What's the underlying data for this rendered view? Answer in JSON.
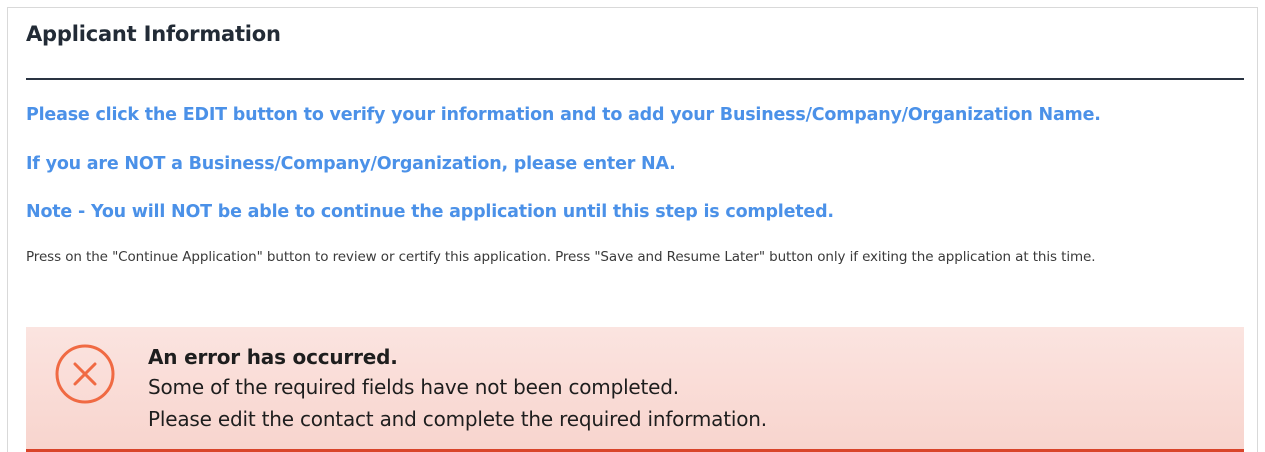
{
  "section": {
    "title": "Applicant Information"
  },
  "instructions": {
    "line1": "Please click the EDIT button to verify your information and to add your Business/Company/Organization Name.",
    "line2": "If you are NOT a Business/Company/Organization, please enter NA.",
    "line3": "Note - You will NOT be able to continue the application until this step is completed."
  },
  "help_text": "Press on the \"Continue Application\" button to review or certify this application. Press \"Save and Resume Later\" button only if exiting the application at this time.",
  "error": {
    "icon": "error-circle-x-icon",
    "heading": "An error has occurred.",
    "line1": "Some of the required fields have not been completed.",
    "line2": "Please edit the contact and complete the required information."
  },
  "colors": {
    "instruction_text": "#4b91e8",
    "error_background": "#fbe4e0",
    "error_accent": "#d9442a",
    "error_icon": "#f06a43"
  }
}
